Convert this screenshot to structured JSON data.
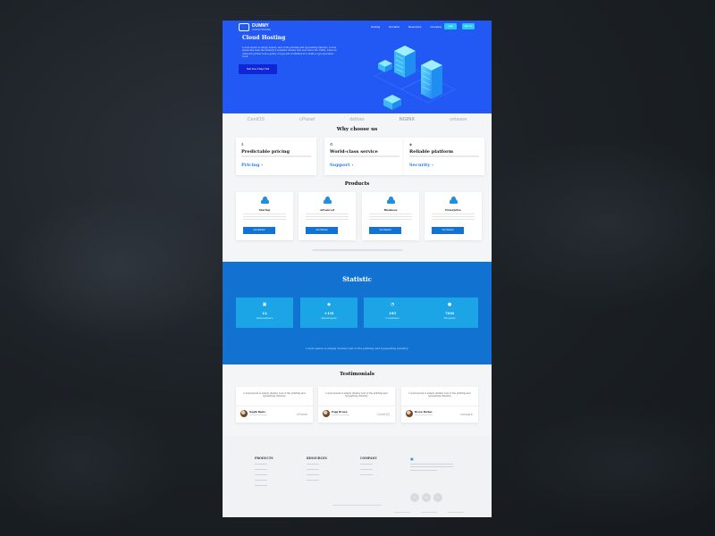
{
  "brand": {
    "name": "DUMMY",
    "tagline": "CLOUD HOSTING"
  },
  "nav": {
    "items": [
      "Hosting",
      "Domains",
      "Resources",
      "Company"
    ],
    "login": "Login",
    "signup": "Sign Up"
  },
  "hero": {
    "title": "Cloud Hosting",
    "text": "Lorem Ipsum is simply dummy text of the printing and typesetting industry. Lorem Ipsum has been the industry's standard dummy text ever since the 1500s, when an unknown printer took a galley of type and scrambled it to make a type specimen book.",
    "cta": "Start Free 3-Days Trial"
  },
  "partners": [
    "CentOS",
    "cPanel",
    "debian",
    "NGINX",
    "vmware"
  ],
  "why": {
    "title": "Why choose us",
    "cards": [
      {
        "icon": "$",
        "title": "Predictable pricing",
        "link": "Pricing ›"
      },
      {
        "icon": "⚙",
        "title": "World-class service",
        "link": "Support ›"
      },
      {
        "icon": "◈",
        "title": "Reliable platform",
        "link": "Security ›"
      }
    ]
  },
  "products": {
    "title": "Products",
    "cards": [
      {
        "name": "Startup",
        "button": "Get Started"
      },
      {
        "name": "Advanced",
        "button": "Get Started"
      },
      {
        "name": "Business",
        "button": "Get Started"
      },
      {
        "name": "Enterprise",
        "button": "Get Started"
      }
    ]
  },
  "statistic": {
    "title": "Statistic",
    "items": [
      {
        "icon": "▣",
        "value": "12",
        "label": "Datacenters"
      },
      {
        "icon": "◆",
        "value": "+1M",
        "label": "Developers"
      },
      {
        "icon": "◔",
        "value": "195",
        "label": "Countries"
      },
      {
        "icon": "●",
        "value": "70M",
        "label": "Droplets"
      }
    ],
    "text": "Lorem Ipsum is simply dummy text of the printing and typesetting industry."
  },
  "testimonials": {
    "title": "Testimonials",
    "items": [
      {
        "quote": "Lorem Ipsum is simply dummy text of the printing and typesetting industry.",
        "name": "Nagib Bento",
        "brand": "cPanel"
      },
      {
        "quote": "Lorem Ipsum is simply dummy text of the printing and typesetting industry.",
        "name": "Pogg Brown",
        "brand": "CentOS"
      },
      {
        "quote": "Lorem Ipsum is simply dummy text of the printing and typesetting industry.",
        "name": "Byron Bother",
        "brand": "vmware"
      }
    ]
  },
  "footer": {
    "columns": [
      {
        "title": "PRODUCTS",
        "links": 6
      },
      {
        "title": "RESOURCES",
        "links": 4
      },
      {
        "title": "COMPANY",
        "links": 3
      }
    ],
    "social": [
      "t",
      "in",
      "f"
    ]
  }
}
